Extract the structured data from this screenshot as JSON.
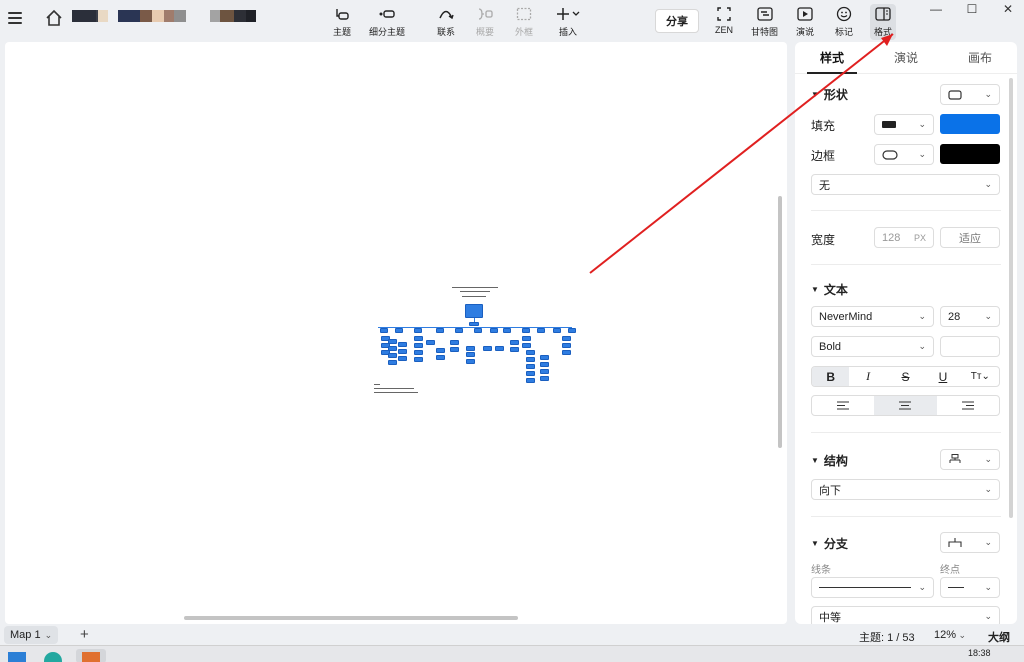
{
  "toolbar": {
    "items": [
      {
        "label": "主题",
        "icon": "topic-icon"
      },
      {
        "label": "细分主题",
        "icon": "subtopic-icon"
      },
      {
        "label": "联系",
        "icon": "relationship-icon"
      },
      {
        "label": "概要",
        "icon": "summary-icon"
      },
      {
        "label": "外框",
        "icon": "boundary-icon"
      },
      {
        "label": "插入",
        "icon": "insert-icon"
      },
      {
        "label": "ZEN",
        "icon": "zen-icon"
      },
      {
        "label": "甘特图",
        "icon": "gantt-icon"
      },
      {
        "label": "演说",
        "icon": "pitch-icon"
      },
      {
        "label": "标记",
        "icon": "marker-icon"
      },
      {
        "label": "格式",
        "icon": "format-icon"
      }
    ],
    "share_label": "分享",
    "swatch_colors": [
      "#2b2f3a",
      "#3b3f4a",
      "#e9d9c4",
      "#2a3554",
      "#3b4460",
      "#7a5a48",
      "#e8cbb0",
      "#a07c6c",
      "#8f8f8f",
      "#a3a3a3",
      "#6d5440",
      "#2d2f36",
      "#1f2127"
    ]
  },
  "panel": {
    "tabs": [
      "样式",
      "演说",
      "画布"
    ],
    "shape": {
      "title": "形状",
      "fill_label": "填充",
      "fill_color": "#0a72e8",
      "border_label": "边框",
      "border_color": "#000000",
      "border_style": "无"
    },
    "width": {
      "label": "宽度",
      "value": "128",
      "unit": "PX",
      "fit_label": "适应"
    },
    "text": {
      "title": "文本",
      "font": "NeverMind",
      "size": "28",
      "weight": "Bold",
      "color_value": ""
    },
    "structure": {
      "title": "结构",
      "direction": "向下"
    },
    "branch": {
      "title": "分支",
      "line_label": "线条",
      "end_label": "终点",
      "thickness": "中等"
    }
  },
  "status": {
    "map_tab": "Map 1",
    "topic_count": "主题: 1 / 53",
    "zoom": "12%",
    "outline": "大纲"
  },
  "taskbar": {
    "time": "18:38"
  },
  "accent": "#2f7de1",
  "annotation_color": "#e02020"
}
